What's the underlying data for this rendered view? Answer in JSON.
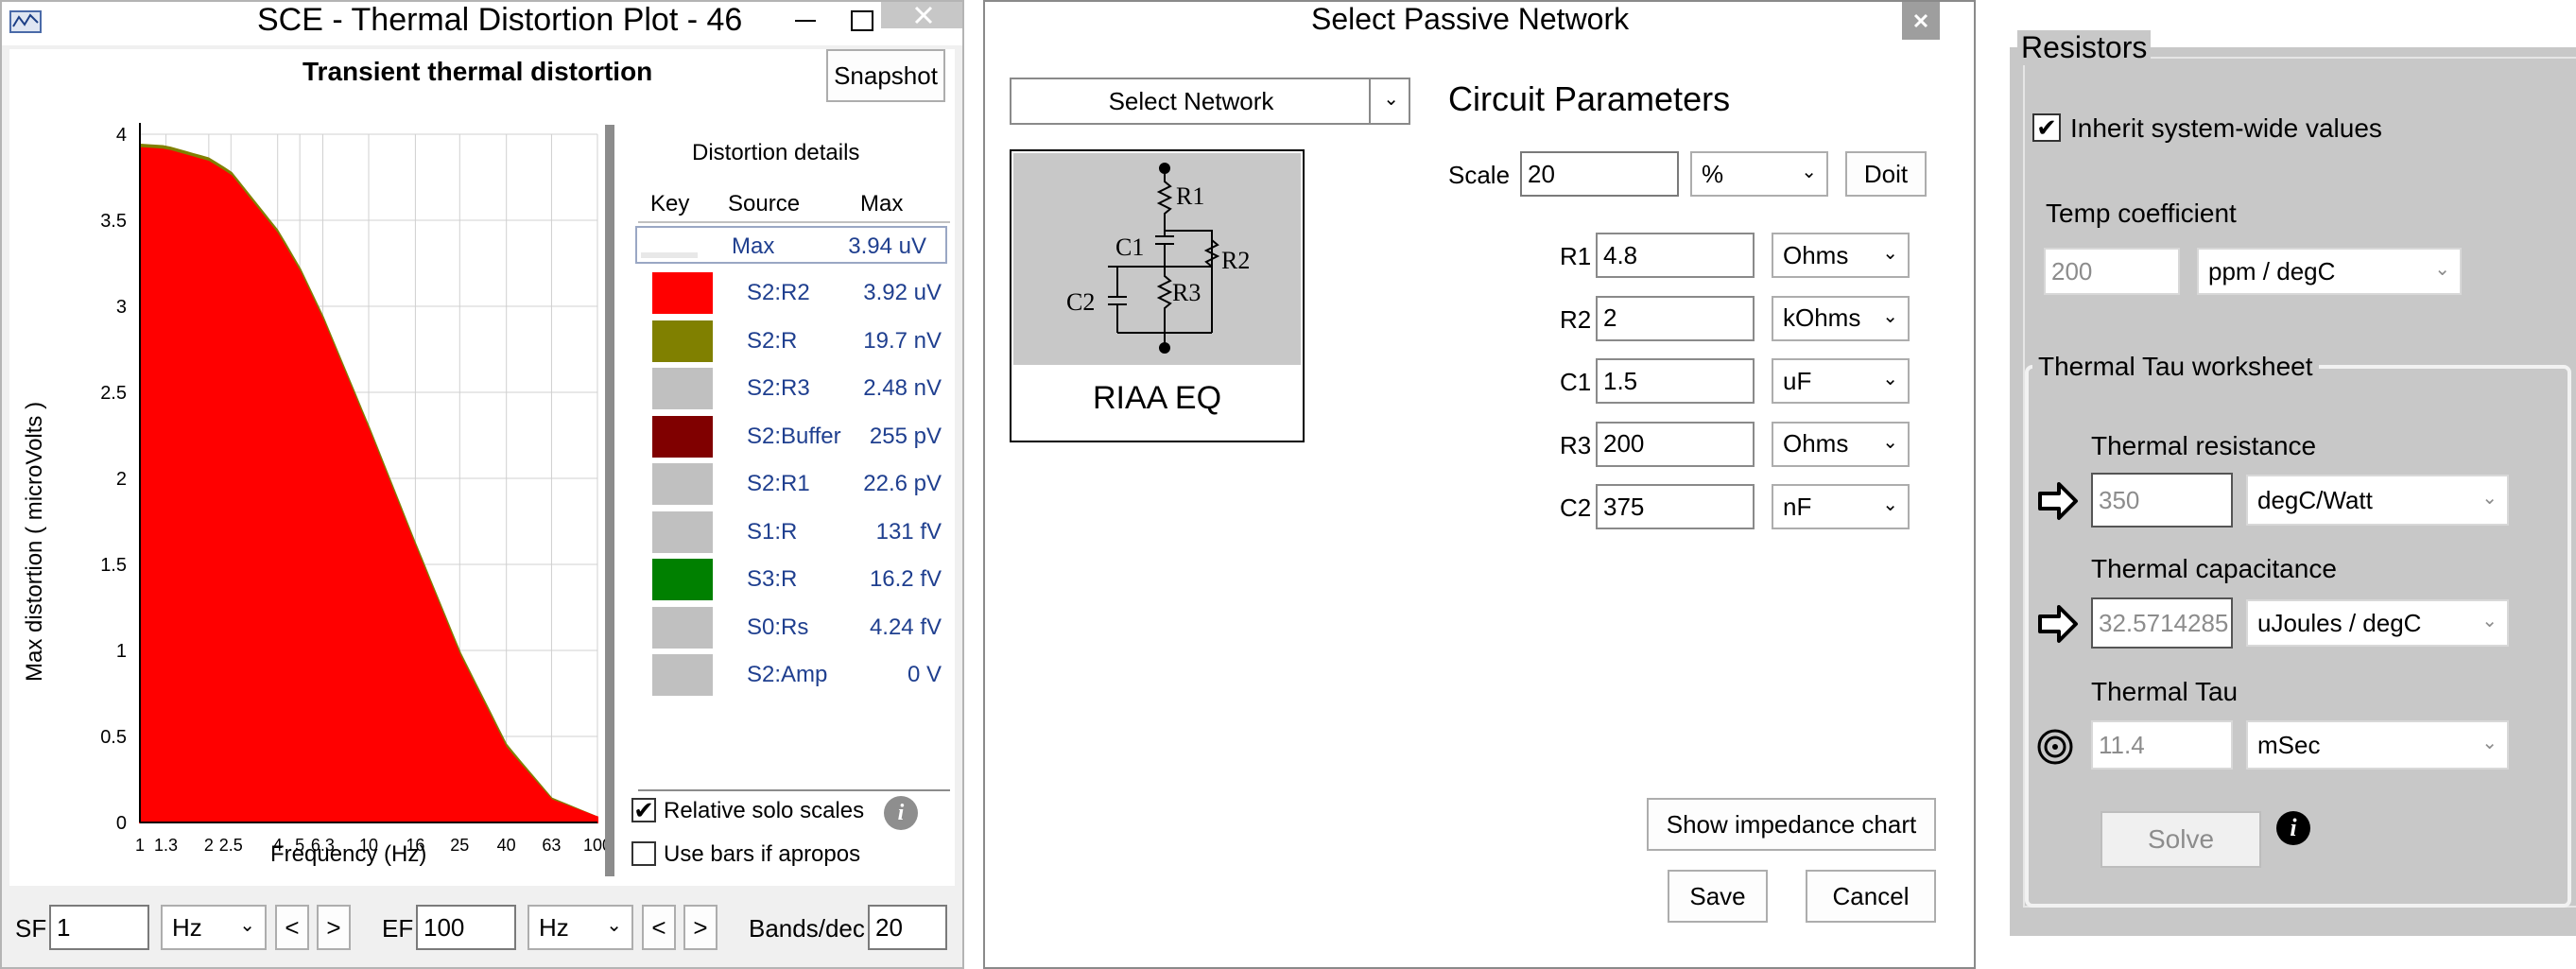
{
  "plot_window": {
    "title": "SCE - Thermal Distortion Plot - 46",
    "snapshot_label": "Snapshot",
    "chart_title": "Transient thermal distortion",
    "ylabel": "Max distortion ( microVolts )",
    "xlabel": "Frequency (Hz)",
    "details_title": "Distortion details",
    "col_key": "Key",
    "col_source": "Source",
    "col_max": "Max",
    "summary": {
      "source": "Max",
      "max": "3.94 uV"
    },
    "rows": [
      {
        "source": "S2:R2",
        "max": "3.92 uV",
        "color": "#ff0000"
      },
      {
        "source": "S2:R",
        "max": "19.7 nV",
        "color": "#808000"
      },
      {
        "source": "S2:R3",
        "max": "2.48 nV",
        "color": "#c0c0c0"
      },
      {
        "source": "S2:Buffer",
        "max": "255 pV",
        "color": "#800000"
      },
      {
        "source": "S2:R1",
        "max": "22.6 pV",
        "color": "#c0c0c0"
      },
      {
        "source": "S1:R",
        "max": "131 fV",
        "color": "#c0c0c0"
      },
      {
        "source": "S3:R",
        "max": "16.2 fV",
        "color": "#008000"
      },
      {
        "source": "S0:Rs",
        "max": "4.24 fV",
        "color": "#c0c0c0"
      },
      {
        "source": "S2:Amp",
        "max": "0 V",
        "color": "#c0c0c0"
      }
    ],
    "relative_solo_label": "Relative solo scales",
    "use_bars_label": "Use bars if apropos",
    "sf_label": "SF",
    "sf_value": "1",
    "sf_unit": "Hz",
    "ef_label": "EF",
    "ef_value": "100",
    "ef_unit": "Hz",
    "prev_btn": "<",
    "next_btn": ">",
    "bands_label": "Bands/dec",
    "bands_value": "20",
    "info_icon": "info-icon"
  },
  "chart_data": {
    "type": "area",
    "title": "Transient thermal distortion",
    "xlabel": "Frequency (Hz)",
    "ylabel": "Max distortion ( microVolts )",
    "x_scale": "log",
    "xlim": [
      1,
      100
    ],
    "ylim": [
      0,
      4
    ],
    "x_ticks": [
      "1",
      "1.3",
      "2",
      "2.5",
      "4",
      "5",
      "6.3",
      "10",
      "16",
      "25",
      "40",
      "63",
      "100"
    ],
    "y_ticks": [
      "0",
      "0.5",
      "1",
      "1.5",
      "2",
      "2.5",
      "3",
      "3.5",
      "4"
    ],
    "grid": true,
    "series": [
      {
        "name": "S2:R2",
        "color": "#ff0000",
        "x": [
          1,
          1.3,
          2,
          2.5,
          4,
          5,
          6.3,
          10,
          16,
          25,
          40,
          63,
          100
        ],
        "y": [
          3.92,
          3.91,
          3.84,
          3.76,
          3.42,
          3.2,
          2.92,
          2.28,
          1.6,
          0.97,
          0.43,
          0.13,
          0.03
        ]
      },
      {
        "name": "S2:R",
        "color": "#808000",
        "x": [
          1,
          1.3,
          2,
          2.5,
          4,
          5,
          6.3,
          10,
          16,
          25,
          40,
          63,
          100
        ],
        "y": [
          3.94,
          3.93,
          3.86,
          3.78,
          3.44,
          3.22,
          2.94,
          2.3,
          1.62,
          0.99,
          0.45,
          0.14,
          0.03
        ]
      }
    ]
  },
  "network_window": {
    "title": "Select Passive Network",
    "select_network": "Select Network",
    "circuit_params_title": "Circuit Parameters",
    "scale_label": "Scale",
    "scale_value": "20",
    "scale_unit": "%",
    "doit_label": "Doit",
    "network_name": "RIAA EQ",
    "schematic_labels": {
      "r1": "R1",
      "r2": "R2",
      "r3": "R3",
      "c1": "C1",
      "c2": "C2"
    },
    "params": [
      {
        "name": "R1",
        "value": "4.8",
        "unit": "Ohms"
      },
      {
        "name": "R2",
        "value": "2",
        "unit": "kOhms"
      },
      {
        "name": "C1",
        "value": "1.5",
        "unit": "uF"
      },
      {
        "name": "R3",
        "value": "200",
        "unit": "Ohms"
      },
      {
        "name": "C2",
        "value": "375",
        "unit": "nF"
      }
    ],
    "impedance_btn": "Show impedance chart",
    "save_btn": "Save",
    "cancel_btn": "Cancel"
  },
  "resistors_panel": {
    "group_title": "Resistors",
    "inherit_label": "Inherit system-wide values",
    "temp_coeff_label": "Temp coefficient",
    "temp_coeff_value": "200",
    "temp_coeff_unit": "ppm / degC",
    "worksheet_title": "Thermal Tau worksheet",
    "thermal_resistance_label": "Thermal resistance",
    "thermal_resistance_value": "350",
    "thermal_resistance_unit": "degC/Watt",
    "thermal_capacitance_label": "Thermal capacitance",
    "thermal_capacitance_value": "32.5714285",
    "thermal_capacitance_unit": "uJoules / degC",
    "thermal_tau_label": "Thermal Tau",
    "thermal_tau_value": "11.4",
    "thermal_tau_unit": "mSec",
    "solve_btn": "Solve"
  }
}
